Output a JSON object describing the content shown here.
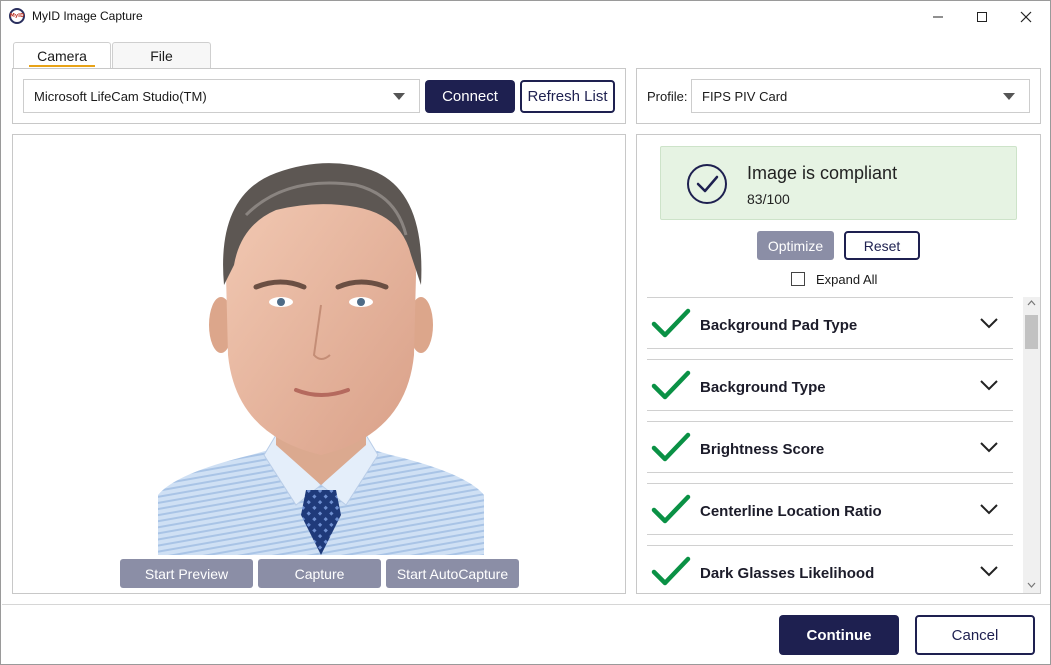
{
  "window": {
    "title": "MyID Image Capture",
    "logo_text": "MyID"
  },
  "tabs": [
    {
      "label": "Camera",
      "selected": true
    },
    {
      "label": "File",
      "selected": false
    }
  ],
  "source": {
    "camera_selected": "Microsoft LifeCam Studio(TM)",
    "connect_label": "Connect",
    "refresh_label": "Refresh List"
  },
  "profile": {
    "label": "Profile:",
    "selected": "FIPS PIV Card"
  },
  "capture": {
    "start_preview_label": "Start Preview",
    "capture_label": "Capture",
    "start_autocapture_label": "Start AutoCapture"
  },
  "compliance": {
    "title": "Image is compliant",
    "score": "83/100",
    "optimize_label": "Optimize",
    "reset_label": "Reset",
    "expand_all_label": "Expand All",
    "status_color": "#1a7f3c"
  },
  "checks": [
    {
      "label": "Background Pad Type",
      "passed": true
    },
    {
      "label": "Background Type",
      "passed": true
    },
    {
      "label": "Brightness Score",
      "passed": true
    },
    {
      "label": "Centerline Location Ratio",
      "passed": true
    },
    {
      "label": "Dark Glasses Likelihood",
      "passed": true
    }
  ],
  "footer": {
    "continue_label": "Continue",
    "cancel_label": "Cancel"
  },
  "colors": {
    "accent_dark": "#1e2050",
    "tab_underline": "#e8a317",
    "compliant_bg": "#e6f3e3",
    "check_green": "#0a9145"
  }
}
